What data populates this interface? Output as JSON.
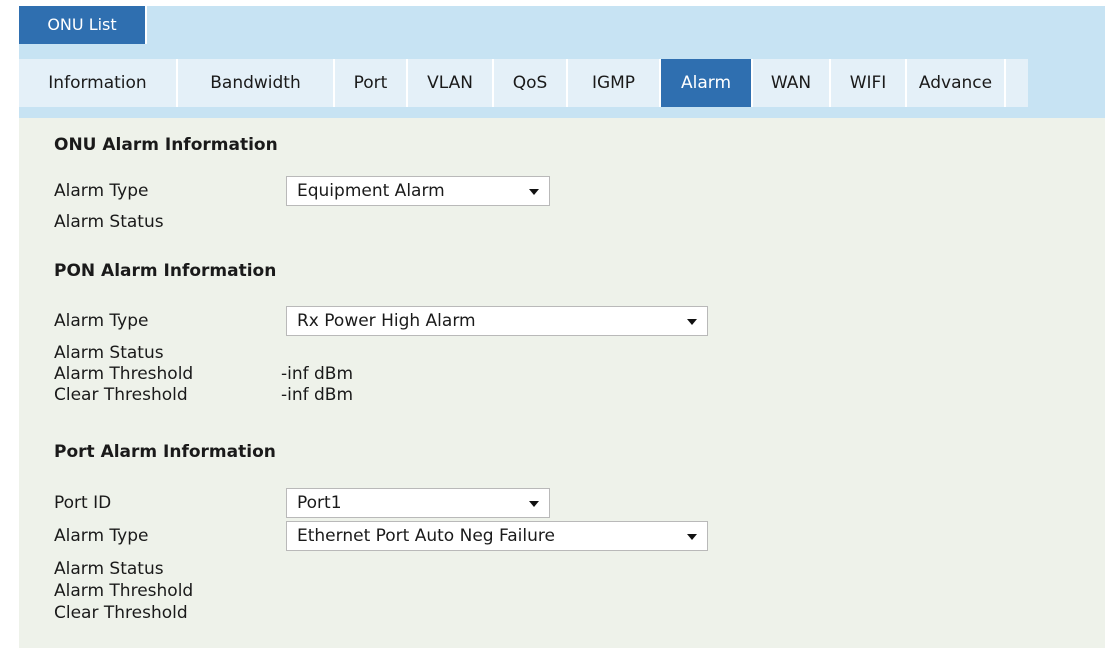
{
  "header": {
    "onu_list_label": "ONU List"
  },
  "tabs": [
    {
      "label": "Information"
    },
    {
      "label": "Bandwidth"
    },
    {
      "label": "Port"
    },
    {
      "label": "VLAN"
    },
    {
      "label": "QoS"
    },
    {
      "label": "IGMP"
    },
    {
      "label": "Alarm",
      "active": true
    },
    {
      "label": "WAN"
    },
    {
      "label": "WIFI"
    },
    {
      "label": "Advance"
    }
  ],
  "onu_alarm": {
    "title": "ONU Alarm Information",
    "alarm_type_label": "Alarm Type",
    "alarm_type_value": "Equipment Alarm",
    "alarm_status_label": "Alarm Status"
  },
  "pon_alarm": {
    "title": "PON Alarm Information",
    "alarm_type_label": "Alarm Type",
    "alarm_type_value": "Rx Power High Alarm",
    "alarm_status_label": "Alarm Status",
    "alarm_threshold_label": "Alarm Threshold",
    "alarm_threshold_value": "-inf dBm",
    "clear_threshold_label": "Clear Threshold",
    "clear_threshold_value": "-inf dBm"
  },
  "port_alarm": {
    "title": "Port Alarm Information",
    "port_id_label": "Port ID",
    "port_id_value": "Port1",
    "alarm_type_label": "Alarm Type",
    "alarm_type_value": "Ethernet Port Auto Neg Failure",
    "alarm_status_label": "Alarm Status",
    "alarm_threshold_label": "Alarm Threshold",
    "clear_threshold_label": "Clear Threshold"
  },
  "colors": {
    "accent": "#2f6fb0",
    "header_bg": "#c7e3f3",
    "tab_bg": "#e4f0f8",
    "content_bg": "#eef2ea"
  }
}
